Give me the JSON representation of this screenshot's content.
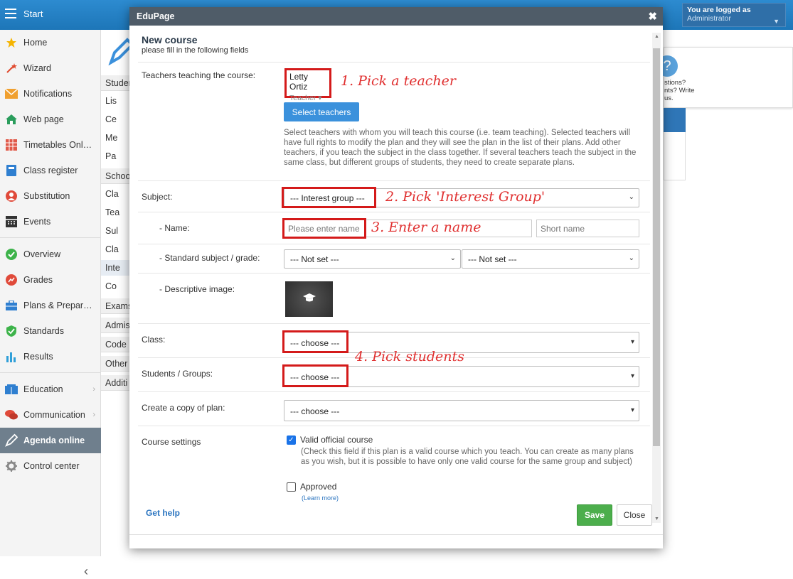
{
  "topbar": {
    "start_label": "Start",
    "login_line1": "You are logged as",
    "login_line2": "Administrator"
  },
  "sidebar": {
    "items": [
      {
        "label": "Home",
        "icon": "star-icon",
        "color": "#f5b400"
      },
      {
        "label": "Wizard",
        "icon": "wand-icon",
        "color": "#e04a2f"
      },
      {
        "label": "Notifications",
        "icon": "envelope-icon",
        "color": "#f0a030"
      },
      {
        "label": "Web page",
        "icon": "home-icon",
        "color": "#2a9d5c"
      },
      {
        "label": "Timetables Onl…",
        "icon": "grid-icon",
        "color": "#e05a4a"
      },
      {
        "label": "Class register",
        "icon": "book-icon",
        "color": "#2f7fd0"
      },
      {
        "label": "Substitution",
        "icon": "person-icon",
        "color": "#e04a3a"
      },
      {
        "label": "Events",
        "icon": "calendar-icon",
        "color": "#333333"
      },
      {
        "label": "Overview",
        "icon": "check-circle-icon",
        "color": "#3db34a"
      },
      {
        "label": "Grades",
        "icon": "chart-circle-icon",
        "color": "#e04a3a"
      },
      {
        "label": "Plans & Prepar…",
        "icon": "briefcase-icon",
        "color": "#2f7fd0"
      },
      {
        "label": "Standards",
        "icon": "shield-check-icon",
        "color": "#3db34a"
      },
      {
        "label": "Results",
        "icon": "bar-chart-icon",
        "color": "#2f9fd8"
      },
      {
        "label": "Education",
        "icon": "education-icon",
        "color": "#2f7fd0"
      },
      {
        "label": "Communication",
        "icon": "chat-icon",
        "color": "#e04a3a"
      },
      {
        "label": "Agenda online",
        "icon": "pen-icon",
        "color": "#ffffff"
      },
      {
        "label": "Control center",
        "icon": "gear-icon",
        "color": "#888888"
      }
    ]
  },
  "subnav": {
    "items": [
      "Studer",
      "Lis",
      "Ce",
      "Me",
      "Pa",
      "Schoo",
      "Cla",
      "Tea",
      "Sul",
      "Cla",
      "Inte",
      "Co",
      "Exams",
      "Admis",
      "Code",
      "Other",
      "Additi"
    ]
  },
  "right_panel": {
    "text": "stions?\nnts? Write\nus."
  },
  "dialog": {
    "title": "EduPage",
    "heading": "New course",
    "subheading": "please fill in the following fields",
    "teachers_label": "Teachers teaching the course:",
    "teacher_name": "Letty Ortiz",
    "teacher_role": "Teacher",
    "select_teachers_button": "Select teachers",
    "teachers_help": "Select teachers with whom you will teach this course (i.e. team teaching). Selected teachers will have full rights to modify the plan and they will see the plan in the list of their plans. Add other teachers, if you teach the subject in the class together. If several teachers teach the subject in the same class, but different groups of students, they need to create separate plans.",
    "subject_label": "Subject:",
    "subject_value": "--- Interest group ---",
    "name_label": "- Name:",
    "name_placeholder": "Please enter name",
    "short_name_placeholder": "Short name",
    "standard_label": "- Standard subject / grade:",
    "standard_subject_value": "--- Not set ---",
    "standard_grade_value": "--- Not set ---",
    "image_label": "- Descriptive image:",
    "class_label": "Class:",
    "class_value": "--- choose ---",
    "students_label": "Students / Groups:",
    "students_value": "--- choose ---",
    "copy_label": "Create a copy of plan:",
    "copy_value": "--- choose ---",
    "settings_label": "Course settings",
    "valid_course_label": "Valid official course",
    "valid_course_checked": true,
    "valid_course_help": "(Check this field if this plan is a valid course which you teach. You can create as many plans as you wish, but it is possible to have only one valid course for the same group and subject)",
    "approved_label": "Approved",
    "approved_checked": false,
    "learn_more": "(Learn more)",
    "get_help": "Get help",
    "save_button": "Save",
    "close_button": "Close"
  },
  "annotations": {
    "a1": "1. Pick a teacher",
    "a2": "2. Pick 'Interest Group'",
    "a3": "3. Enter a name",
    "a4": "4. Pick students",
    "color": "#d41a1a"
  }
}
